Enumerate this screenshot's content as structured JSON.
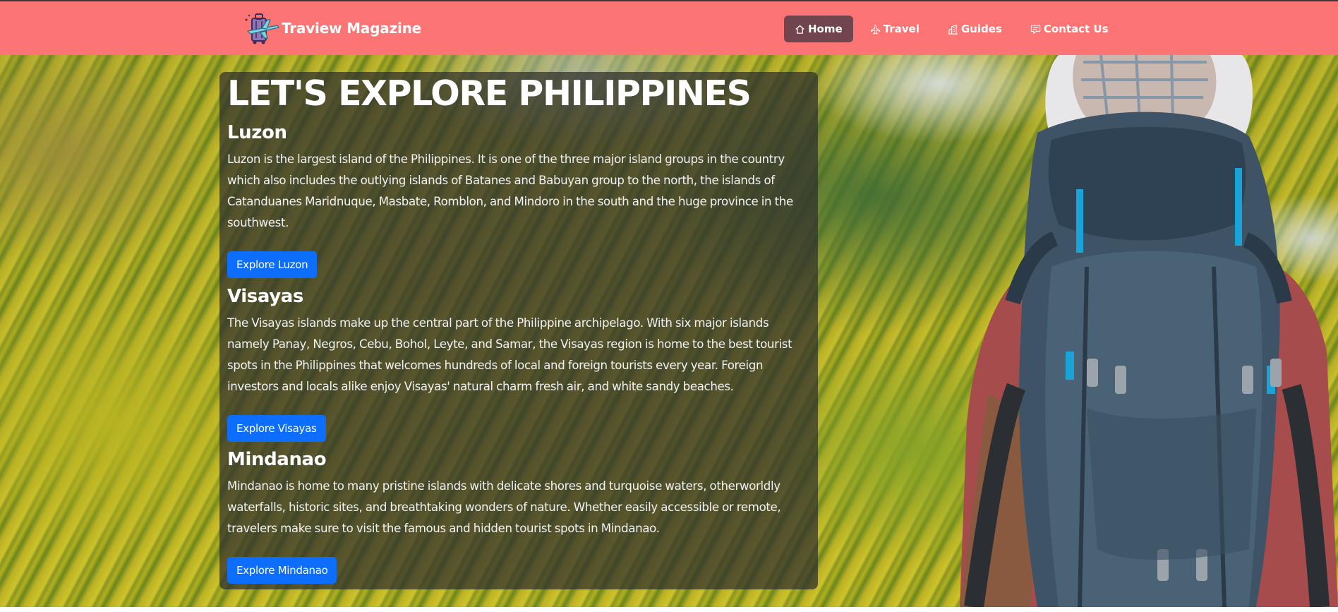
{
  "navbar": {
    "brand": {
      "name": "Traview Magazine",
      "logo_icon": "suitcase-airplane-icon"
    },
    "links": [
      {
        "label": "Home",
        "icon": "house-icon",
        "active": true
      },
      {
        "label": "Travel",
        "icon": "airplane-icon",
        "active": false
      },
      {
        "label": "Guides",
        "icon": "building-icon",
        "active": false
      },
      {
        "label": "Contact Us",
        "icon": "chat-square-icon",
        "active": false
      }
    ],
    "colors": {
      "background": "#fc7474",
      "active_background": "#70454d",
      "text": "#ffffff"
    }
  },
  "hero": {
    "title": "LET'S EXPLORE PHILIPPINES",
    "background_image": "rice-terraces-photo",
    "foreground_image": "backpacker-photo",
    "sections": [
      {
        "heading": "Luzon",
        "text": "Luzon is the largest island of the Philippines. It is one of the three major island groups in the country which also includes the outlying islands of Batanes and Babuyan group to the north, the islands of Catanduanes Maridnuque, Masbate, Romblon, and Mindoro in the south and the huge province in the southwest.",
        "button": "Explore Luzon"
      },
      {
        "heading": "Visayas",
        "text": "The Visayas islands make up the central part of the Philippine archipelago. With six major islands namely Panay, Negros, Cebu, Bohol, Leyte, and Samar, the Visayas region is home to the best tourist spots in the Philippines that welcomes hundreds of local and foreign tourists every year. Foreign investors and locals alike enjoy Visayas' natural charm fresh air, and white sandy beaches.",
        "button": "Explore Visayas"
      },
      {
        "heading": "Mindanao",
        "text": "Mindanao is home to many pristine islands with delicate shores and turquoise waters, otherworldly waterfalls, historic sites, and breathtaking wonders of nature. Whether easily accessible or remote, travelers make sure to visit the famous and hidden tourist spots in Mindanao.",
        "button": "Explore Mindanao"
      }
    ],
    "colors": {
      "button": "#0d6efd",
      "card": "rgba(46,46,46,0.72)"
    }
  }
}
